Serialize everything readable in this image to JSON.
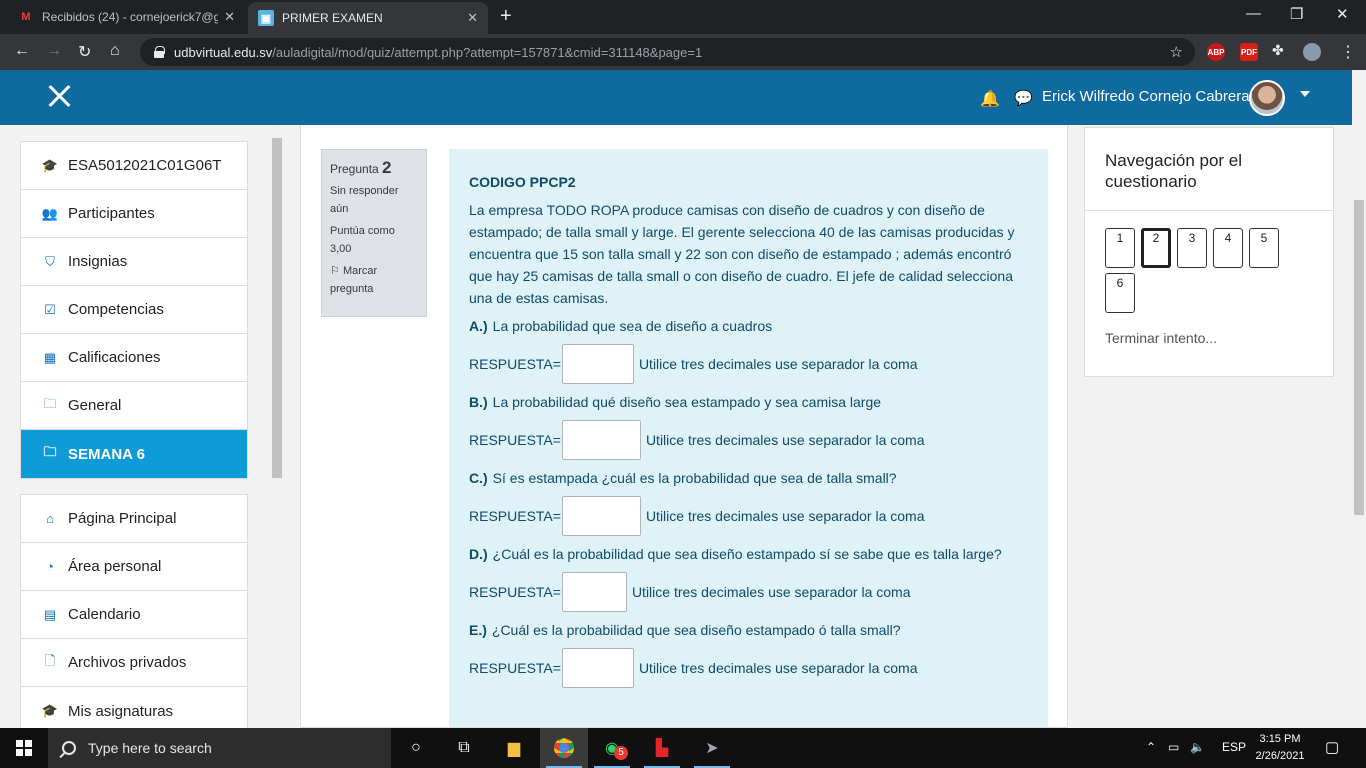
{
  "browser": {
    "tabs": [
      {
        "title": "Recibidos (24) - cornejoerick7@g",
        "icon": "gmail-icon"
      },
      {
        "title": "PRIMER EXAMEN",
        "icon": "moodle-quiz-icon"
      }
    ],
    "url_host": "udbvirtual.edu.sv",
    "url_path": "/auladigital/mod/quiz/attempt.php?attempt=157871&cmid=311148&page=1",
    "extensions": [
      "ABP",
      "PDF"
    ]
  },
  "navbar": {
    "user_name": "Erick Wilfredo Cornejo Cabrera",
    "color": "#0f6a9f"
  },
  "drawer": {
    "course_items": [
      {
        "label": "ESA5012021C01G06T",
        "icon": "graduation-cap-icon",
        "glyph": "🎓"
      },
      {
        "label": "Participantes",
        "icon": "users-icon",
        "glyph": "👥"
      },
      {
        "label": "Insignias",
        "icon": "shield-icon",
        "glyph": "⛉"
      },
      {
        "label": "Competencias",
        "icon": "checkbox-icon",
        "glyph": "☑"
      },
      {
        "label": "Calificaciones",
        "icon": "table-icon",
        "glyph": "▦"
      },
      {
        "label": "General",
        "icon": "folder-icon",
        "glyph": "🗀"
      },
      {
        "label": "SEMANA 6",
        "icon": "folder-icon",
        "glyph": "🗀"
      }
    ],
    "site_items": [
      {
        "label": "Página Principal",
        "icon": "home-icon",
        "glyph": "⌂"
      },
      {
        "label": "Área personal",
        "icon": "dashboard-icon",
        "glyph": "◔"
      },
      {
        "label": "Calendario",
        "icon": "calendar-icon",
        "glyph": "▤"
      },
      {
        "label": "Archivos privados",
        "icon": "file-icon",
        "glyph": "🗋"
      },
      {
        "label": "Mis asignaturas",
        "icon": "graduation-cap-icon",
        "glyph": "🎓"
      }
    ],
    "active_color": "#0f9bd8"
  },
  "question": {
    "info_label": "Pregunta",
    "number": "2",
    "status": "Sin responder aún",
    "score": "Puntúa como 3,00",
    "flag": "Marcar pregunta",
    "code": "CODIGO PPCP2",
    "statement": "La empresa TODO ROPA produce camisas con diseño de cuadros y con diseño de estampado; de talla small y large. El gerente selecciona 40 de las camisas producidas y encuentra que 15 son talla small y 22 son con diseño de estampado ; además encontró que hay 25 camisas de talla small o con diseño de cuadro. El jefe de calidad selecciona una de estas camisas.",
    "answer_label": "RESPUESTA=",
    "hint": "Utilice tres decimales use separador la coma",
    "parts": [
      {
        "letter": "A.)",
        "text": "La probabilidad que sea de diseño a cuadros"
      },
      {
        "letter": "B.)",
        "text": "La probabilidad qué diseño sea estampado y sea camisa large"
      },
      {
        "letter": "C.)",
        "text": "Sí es estampada ¿cuál es la probabilidad que sea de talla small?"
      },
      {
        "letter": "D.)",
        "text": "¿Cuál es la probabilidad que sea diseño estampado sí se sabe que es talla large?"
      },
      {
        "letter": "E.)",
        "text": "¿Cuál es la probabilidad que sea diseño estampado ó talla small?"
      }
    ],
    "box_color": "#def2f8"
  },
  "quiz_nav": {
    "title": "Navegación por el cuestionario",
    "buttons": [
      "1",
      "2",
      "3",
      "4",
      "5",
      "6"
    ],
    "current": "2",
    "finish": "Terminar intento..."
  },
  "taskbar": {
    "search_placeholder": "Type here to search",
    "whatsapp_badge": "5",
    "language": "ESP",
    "time": "3:15 PM",
    "date": "2/26/2021"
  }
}
